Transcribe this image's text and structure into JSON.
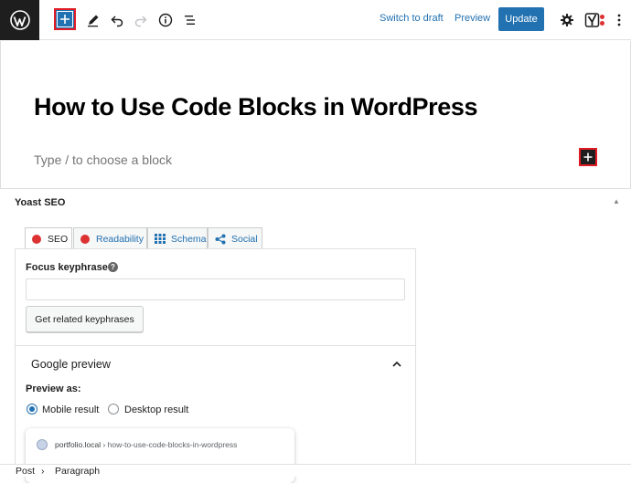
{
  "toolbar": {
    "switch_to_draft": "Switch to draft",
    "preview": "Preview",
    "update": "Update"
  },
  "editor": {
    "post_title": "How to Use Code Blocks in WordPress",
    "placeholder": "Type / to choose a block"
  },
  "yoast": {
    "title": "Yoast SEO",
    "tabs": [
      {
        "label": "SEO",
        "icon": "red-dot-icon"
      },
      {
        "label": "Readability",
        "icon": "red-dot-icon"
      },
      {
        "label": "Schema",
        "icon": "grid-icon"
      },
      {
        "label": "Social",
        "icon": "share-icon"
      }
    ],
    "focus_keyphrase_label": "Focus keyphrase",
    "focus_keyphrase_value": "",
    "related_button": "Get related keyphrases",
    "google_preview_title": "Google preview",
    "preview_as_label": "Preview as:",
    "mobile_result": "Mobile result",
    "desktop_result": "Desktop result",
    "serp_site": "portfolio.local",
    "serp_path": "› how-to-use-code-blocks-in-wordpress"
  },
  "breadcrumb": {
    "post": "Post",
    "separator": "›",
    "paragraph": "Paragraph"
  },
  "colors": {
    "accent": "#2271b1",
    "highlight": "#e01b24",
    "score_bad": "#dc3232"
  }
}
